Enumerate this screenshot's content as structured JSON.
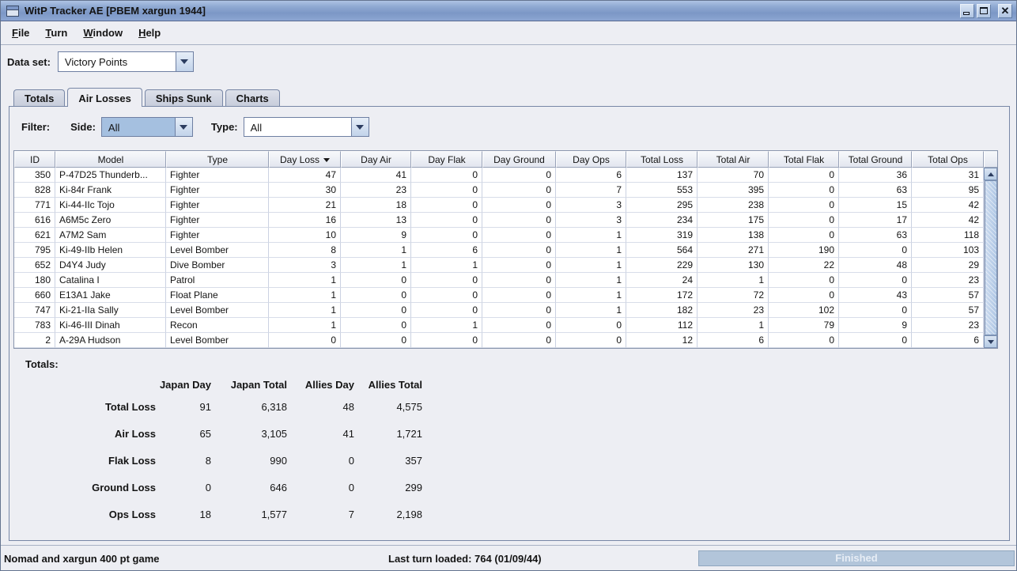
{
  "window": {
    "title": "WitP Tracker AE [PBEM xargun 1944]"
  },
  "menu": {
    "items": [
      "File",
      "Turn",
      "Window",
      "Help"
    ]
  },
  "dataset": {
    "label": "Data set:",
    "value": "Victory Points"
  },
  "tabs": {
    "items": [
      "Totals",
      "Air Losses",
      "Ships Sunk",
      "Charts"
    ],
    "selected": "Air Losses"
  },
  "filter": {
    "label": "Filter:",
    "side_label": "Side:",
    "side_value": "All",
    "type_label": "Type:",
    "type_value": "All"
  },
  "table": {
    "columns": [
      "ID",
      "Model",
      "Type",
      "Day Loss",
      "Day Air",
      "Day Flak",
      "Day Ground",
      "Day Ops",
      "Total Loss",
      "Total Air",
      "Total Flak",
      "Total Ground",
      "Total Ops"
    ],
    "sort_column": "Day Loss",
    "sort_direction": "desc",
    "rows": [
      [
        "350",
        "P-47D25 Thunderb...",
        "Fighter",
        "47",
        "41",
        "0",
        "0",
        "6",
        "137",
        "70",
        "0",
        "36",
        "31"
      ],
      [
        "828",
        "Ki-84r Frank",
        "Fighter",
        "30",
        "23",
        "0",
        "0",
        "7",
        "553",
        "395",
        "0",
        "63",
        "95"
      ],
      [
        "771",
        "Ki-44-IIc Tojo",
        "Fighter",
        "21",
        "18",
        "0",
        "0",
        "3",
        "295",
        "238",
        "0",
        "15",
        "42"
      ],
      [
        "616",
        "A6M5c Zero",
        "Fighter",
        "16",
        "13",
        "0",
        "0",
        "3",
        "234",
        "175",
        "0",
        "17",
        "42"
      ],
      [
        "621",
        "A7M2 Sam",
        "Fighter",
        "10",
        "9",
        "0",
        "0",
        "1",
        "319",
        "138",
        "0",
        "63",
        "118"
      ],
      [
        "795",
        "Ki-49-IIb Helen",
        "Level Bomber",
        "8",
        "1",
        "6",
        "0",
        "1",
        "564",
        "271",
        "190",
        "0",
        "103"
      ],
      [
        "652",
        "D4Y4 Judy",
        "Dive Bomber",
        "3",
        "1",
        "1",
        "0",
        "1",
        "229",
        "130",
        "22",
        "48",
        "29"
      ],
      [
        "180",
        "Catalina I",
        "Patrol",
        "1",
        "0",
        "0",
        "0",
        "1",
        "24",
        "1",
        "0",
        "0",
        "23"
      ],
      [
        "660",
        "E13A1 Jake",
        "Float Plane",
        "1",
        "0",
        "0",
        "0",
        "1",
        "172",
        "72",
        "0",
        "43",
        "57"
      ],
      [
        "747",
        "Ki-21-IIa Sally",
        "Level Bomber",
        "1",
        "0",
        "0",
        "0",
        "1",
        "182",
        "23",
        "102",
        "0",
        "57"
      ],
      [
        "783",
        "Ki-46-III Dinah",
        "Recon",
        "1",
        "0",
        "1",
        "0",
        "0",
        "112",
        "1",
        "79",
        "9",
        "23"
      ],
      [
        "2",
        "A-29A Hudson",
        "Level Bomber",
        "0",
        "0",
        "0",
        "0",
        "0",
        "12",
        "6",
        "0",
        "0",
        "6"
      ]
    ]
  },
  "totals": {
    "title": "Totals:",
    "columns": [
      "Japan Day",
      "Japan Total",
      "Allies Day",
      "Allies Total"
    ],
    "rows": [
      {
        "label": "Total Loss",
        "values": [
          "91",
          "6,318",
          "48",
          "4,575"
        ]
      },
      {
        "label": "Air Loss",
        "values": [
          "65",
          "3,105",
          "41",
          "1,721"
        ]
      },
      {
        "label": "Flak Loss",
        "values": [
          "8",
          "990",
          "0",
          "357"
        ]
      },
      {
        "label": "Ground Loss",
        "values": [
          "0",
          "646",
          "0",
          "299"
        ]
      },
      {
        "label": "Ops Loss",
        "values": [
          "18",
          "1,577",
          "7",
          "2,198"
        ]
      }
    ]
  },
  "statusbar": {
    "left": "Nomad and xargun 400 pt game",
    "center": "Last turn loaded: 764 (01/09/44)",
    "button": "Finished"
  },
  "colors": {
    "titlebar_top": "#AEC3E3",
    "titlebar_bottom": "#7C97C6",
    "panel_bg": "#EDEEF3",
    "combo_focus": "#A5C0E0",
    "disabled_button_bg": "#B2C5DA",
    "disabled_button_text": "#E7EDF5"
  }
}
